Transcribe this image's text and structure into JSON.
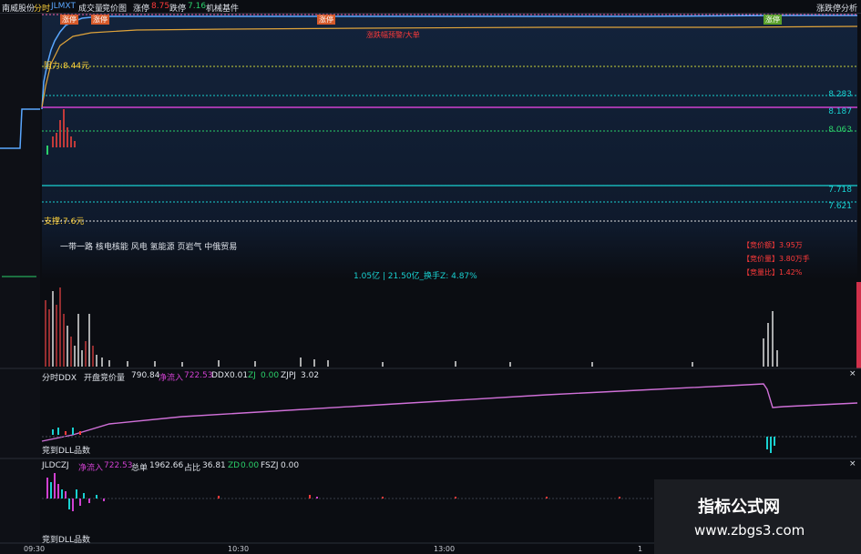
{
  "topbar": {
    "stock": "南威股份",
    "tab_ticks": "分时",
    "jlmxt": "JLMXT",
    "volume": "成交量",
    "auction": "竞价图",
    "rise_label": "涨停",
    "rise_value": "8.75",
    "fall_label": "跌停",
    "fall_value": "7.16",
    "sector": "机械基件",
    "right_title": "涨跌停分析"
  },
  "price_panel": {
    "tags": {
      "t1": "涨停",
      "t2": "涨停",
      "t3": "涨停",
      "t4": "涨停"
    },
    "center_note": "涨跌幅预警/大单",
    "resistance": "阻力:8.44元",
    "support": "支撑:7.6元",
    "levels": [
      "8.283",
      "8.187",
      "8.063",
      "7.718",
      "7.621"
    ],
    "news": "一带一路 核电核能 风电 氢能源 页岩气 中俄贸易",
    "turnover": "1.05亿 | 21.50亿_换手Z: 4.87%",
    "red_notes": [
      "【竞价额】3.95万",
      "【竞价量】3.80万手",
      "【竞量比】1.42%"
    ]
  },
  "ddx_panel": {
    "title": "分时DDX",
    "open_label": "开盘竞价量",
    "open_value": "790.84",
    "net_label": "净流入",
    "net_value": "722.53",
    "ddx_label": "DDX",
    "ddx_value": "0.01",
    "zj_label": "ZJ",
    "zj_value": "0.00",
    "zjpj_label": "ZJPJ",
    "zjpj_value": "3.02",
    "footer": "竞到DLL品数"
  },
  "jldczj_panel": {
    "title": "JLDCZJ",
    "net_label": "净流入",
    "net_value": "722.53",
    "total_label": "总单",
    "total_value": "1962.66",
    "ratio_label": "占比",
    "ratio_value": "36.81",
    "zd_label": "ZD",
    "zd_value": "0.00",
    "fszj_label": "FSZJ",
    "fszj_value": "0.00",
    "footer": "竞到DLL品数"
  },
  "time_axis": [
    "09:30",
    "10:30",
    "13:00",
    "1"
  ],
  "watermark": {
    "title": "指标公式网",
    "url": "www.zbgs3.com"
  },
  "colors": {
    "background": "#0b0d12",
    "price_line": "#5aa7ff",
    "avg_line": "#e0a43a",
    "rise": "#ff3a3a",
    "fall": "#2bd06a",
    "magenta": "#d040d0",
    "cyan": "#19d1d1"
  }
}
